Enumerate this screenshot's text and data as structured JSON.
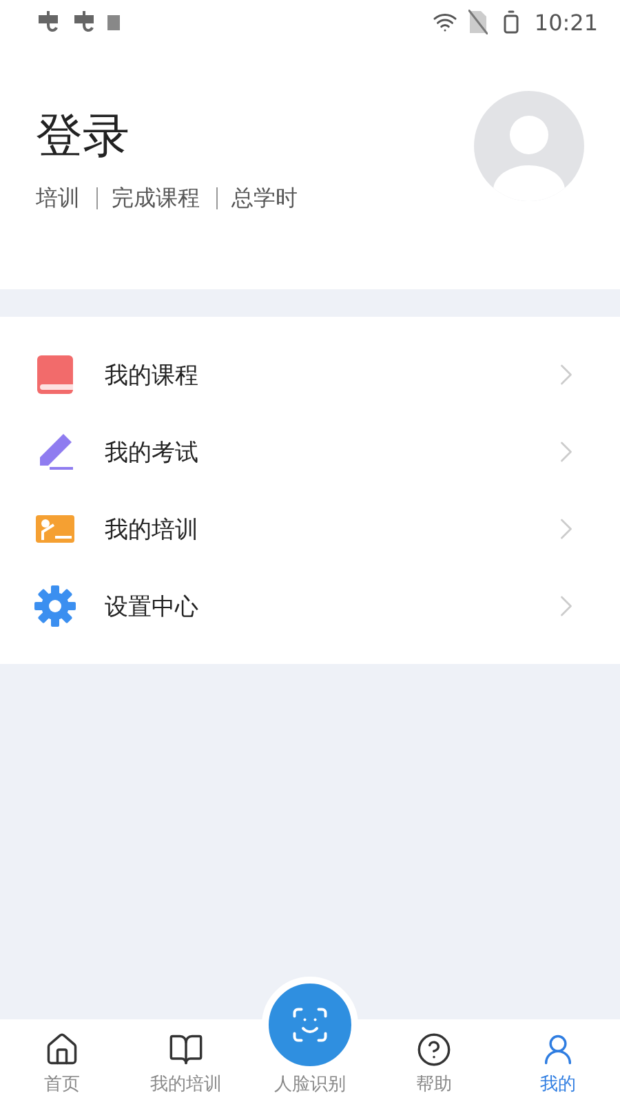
{
  "status_bar": {
    "time": "10:21"
  },
  "profile": {
    "title": "登录",
    "stats": [
      "培训",
      "完成课程",
      "总学时"
    ]
  },
  "menu": [
    {
      "kind": "course",
      "label": "我的课程"
    },
    {
      "kind": "exam",
      "label": "我的考试"
    },
    {
      "kind": "training",
      "label": "我的培训"
    },
    {
      "kind": "settings",
      "label": "设置中心"
    }
  ],
  "tabs": [
    {
      "kind": "home",
      "label": "首页",
      "selected": false
    },
    {
      "kind": "book",
      "label": "我的培训",
      "selected": false
    },
    {
      "kind": "face",
      "label": "人脸识别",
      "selected": false
    },
    {
      "kind": "help",
      "label": "帮助",
      "selected": false
    },
    {
      "kind": "user",
      "label": "我的",
      "selected": true
    }
  ]
}
